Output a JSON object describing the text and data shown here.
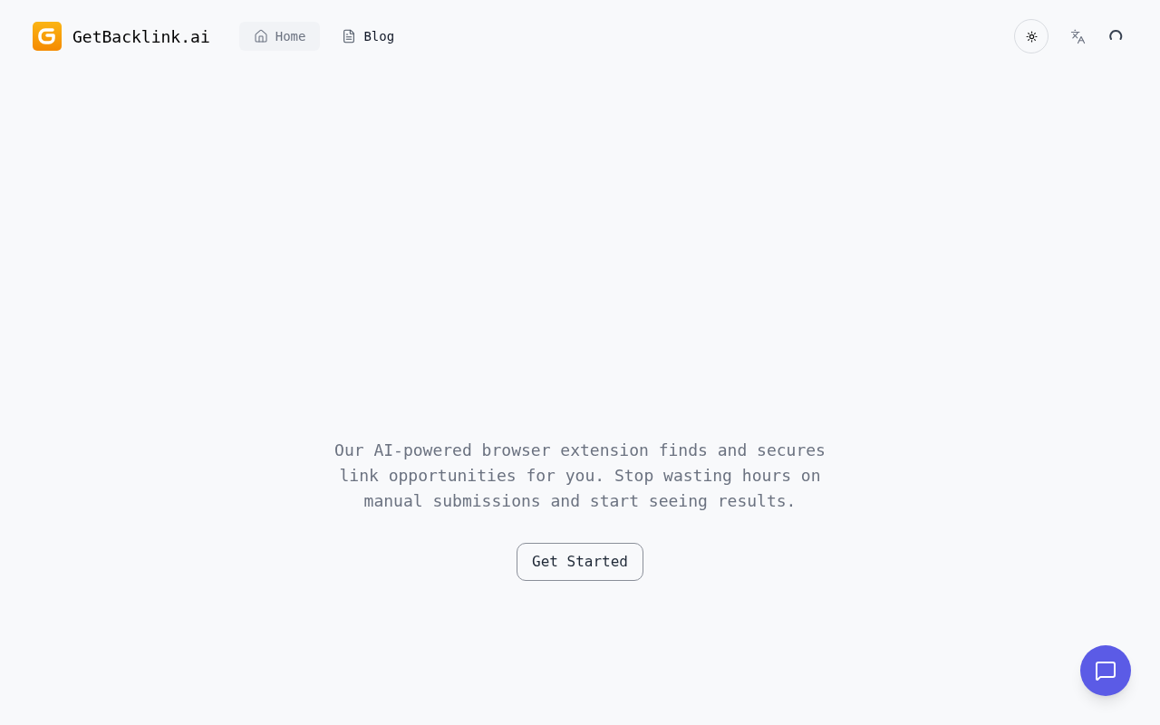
{
  "header": {
    "brand": "GetBacklink.ai",
    "nav": [
      {
        "label": "Home",
        "kind": "home",
        "selected": true
      },
      {
        "label": "Blog",
        "kind": "blog",
        "selected": false
      }
    ]
  },
  "hero": {
    "description": "Our AI-powered browser extension finds and secures link opportunities for you. Stop wasting hours on manual submissions and start seeing results.",
    "cta": "Get Started"
  }
}
